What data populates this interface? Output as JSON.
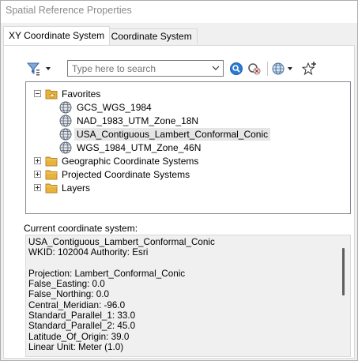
{
  "window": {
    "title": "Spatial Reference Properties"
  },
  "tabs": [
    {
      "label": "XY Coordinate System",
      "active": true
    },
    {
      "label": "Z Coordinate System",
      "active": false
    }
  ],
  "toolbar": {
    "filter_icon": "filter-icon",
    "search_placeholder": "Type here to search",
    "search_value": "",
    "search_go_icon": "search-icon",
    "clear_icon": "clear-search-icon",
    "globe_icon": "globe-dropdown-icon",
    "add_favorite_icon": "add-favorite-icon"
  },
  "tree": {
    "favorites": {
      "label": "Favorites",
      "expanded": true
    },
    "favorites_items": [
      {
        "label": "GCS_WGS_1984",
        "selected": false
      },
      {
        "label": "NAD_1983_UTM_Zone_18N",
        "selected": false
      },
      {
        "label": "USA_Contiguous_Lambert_Conformal_Conic",
        "selected": true
      },
      {
        "label": "WGS_1984_UTM_Zone_46N",
        "selected": false
      }
    ],
    "folders": [
      {
        "label": "Geographic Coordinate Systems",
        "expanded": false
      },
      {
        "label": "Projected Coordinate Systems",
        "expanded": false
      },
      {
        "label": "Layers",
        "expanded": false
      }
    ]
  },
  "current": {
    "label": "Current coordinate system:",
    "lines": [
      "USA_Contiguous_Lambert_Conformal_Conic",
      "WKID: 102004 Authority: Esri",
      "",
      "Projection: Lambert_Conformal_Conic",
      "False_Easting: 0.0",
      "False_Northing: 0.0",
      "Central_Meridian: -96.0",
      "Standard_Parallel_1: 33.0",
      "Standard_Parallel_2: 45.0",
      "Latitude_Of_Origin: 39.0",
      "Linear Unit: Meter (1.0)"
    ]
  },
  "colors": {
    "folder": "#e8b33b",
    "selection": "#e5e5e5",
    "accent": "#1e73c8"
  }
}
